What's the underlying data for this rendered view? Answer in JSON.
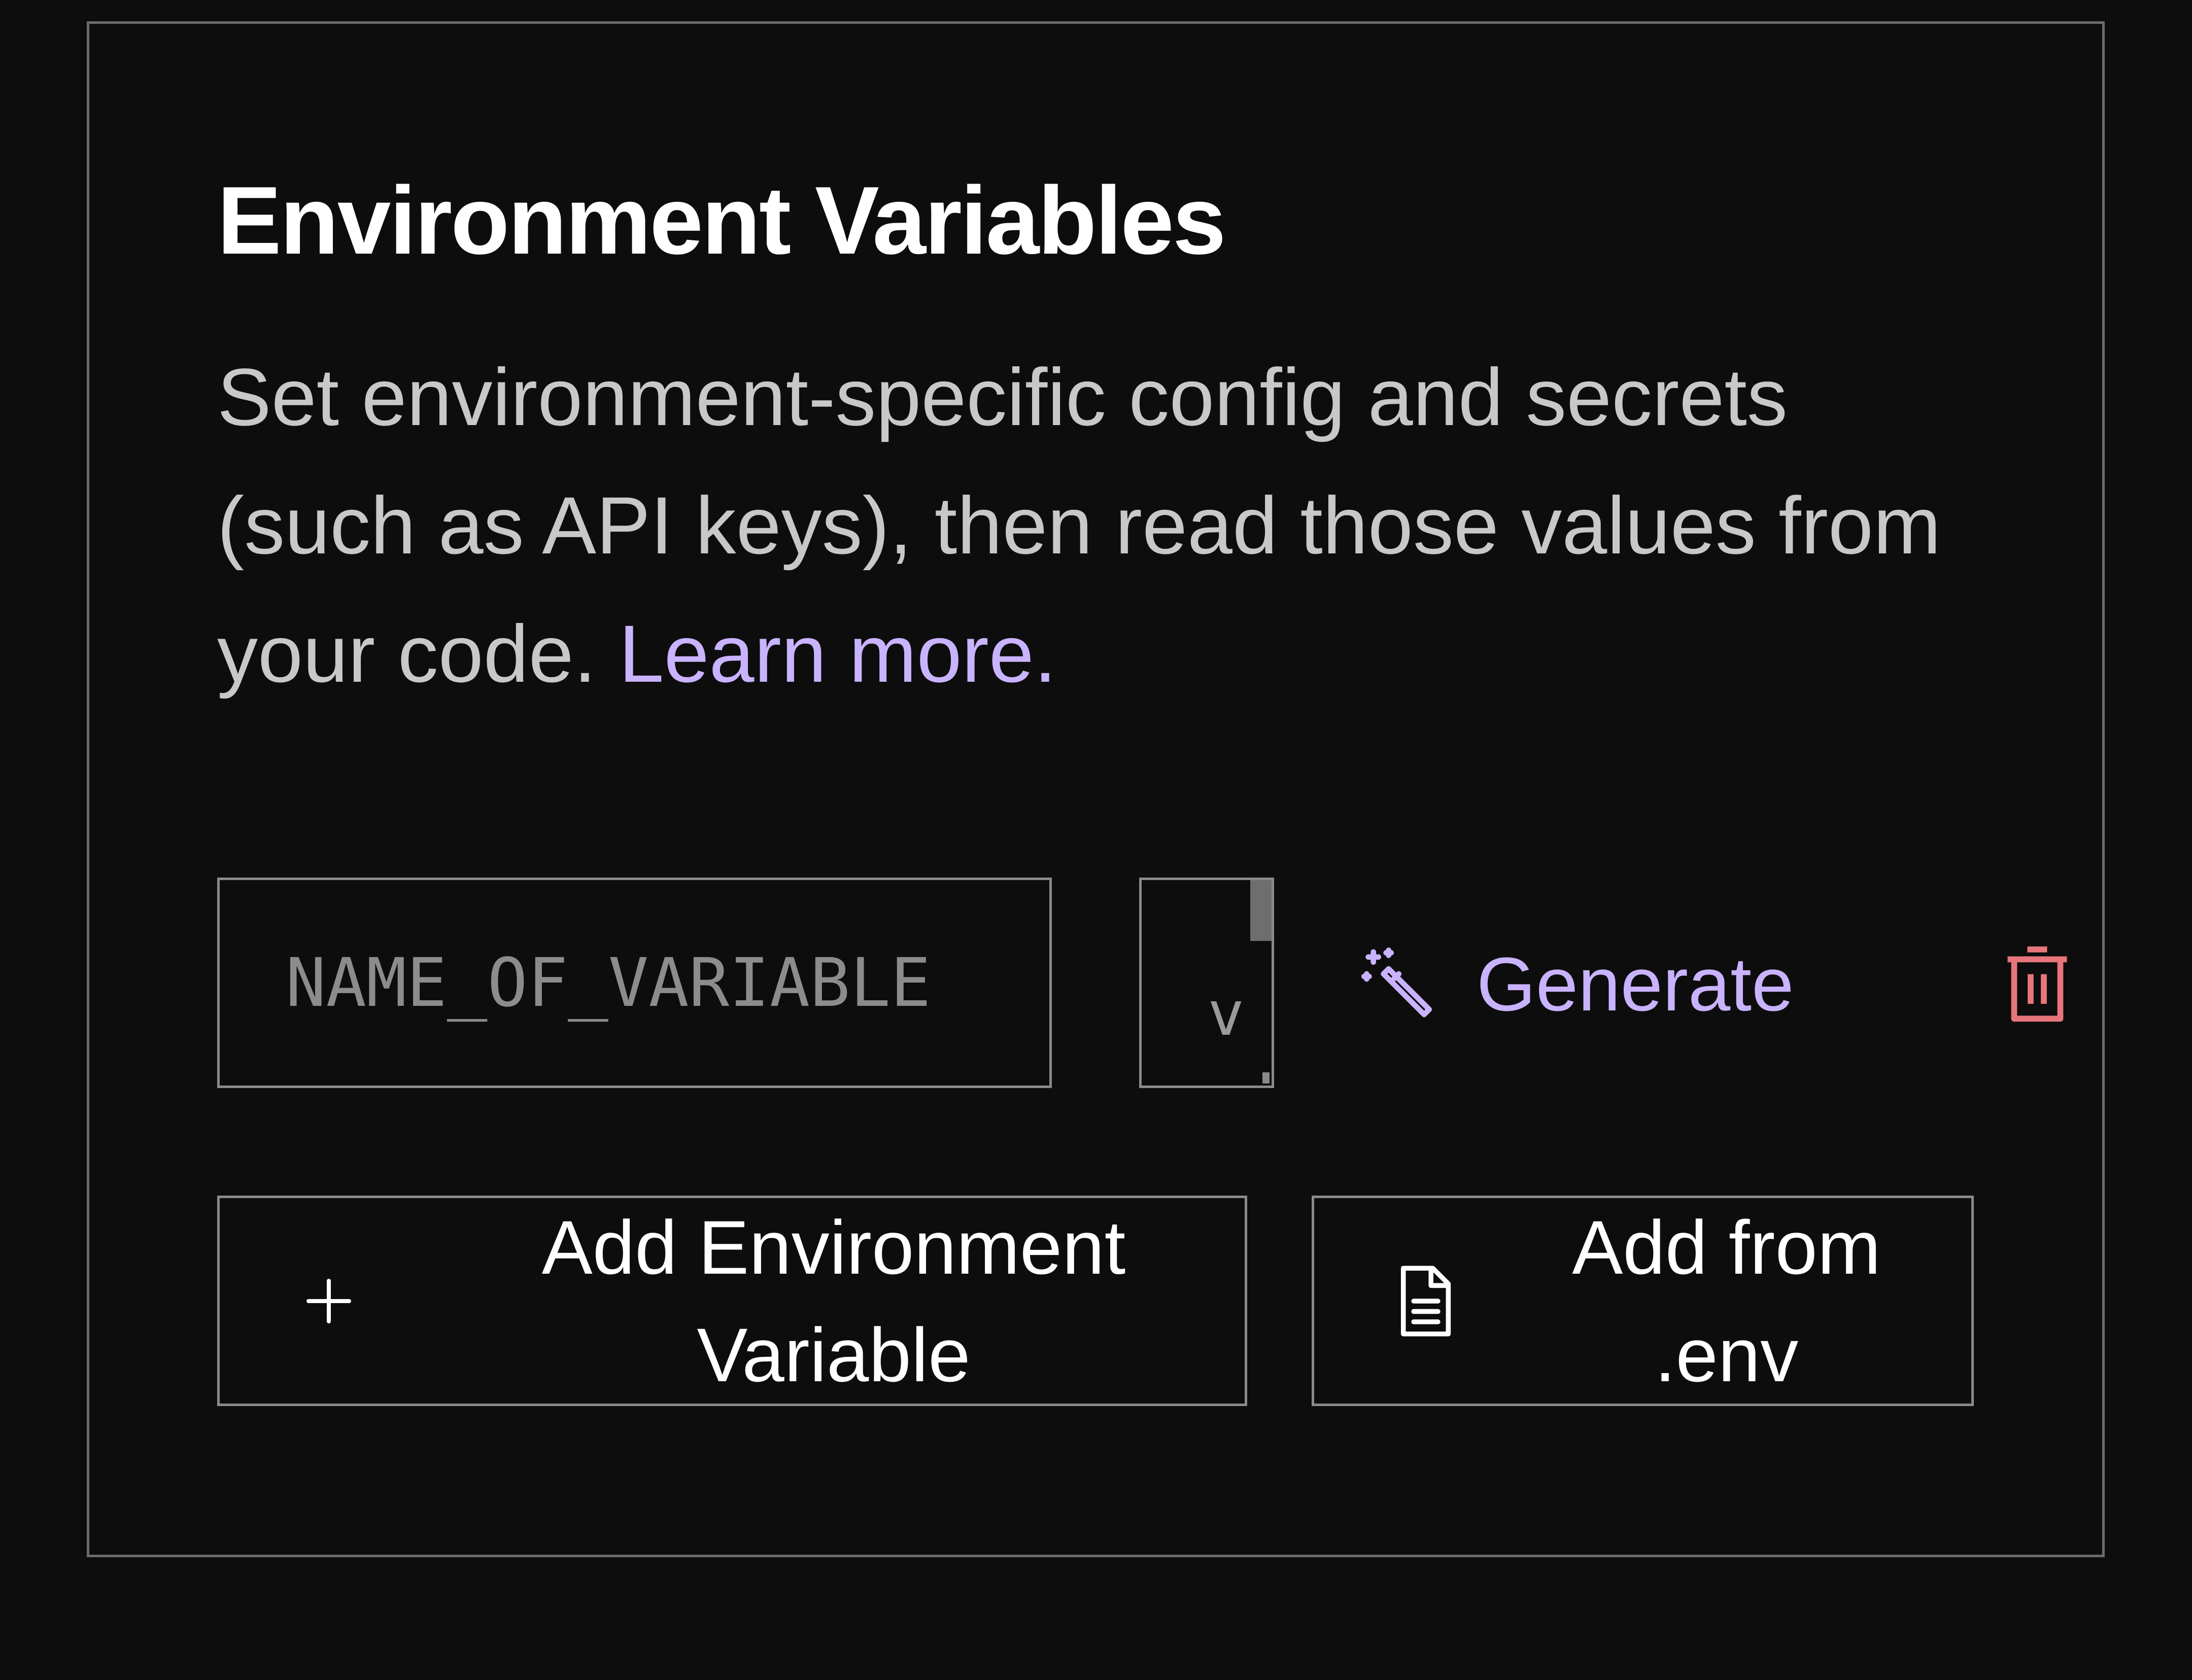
{
  "section": {
    "title": "Environment Variables",
    "description": "Set environment-specific config and secrets (such as API keys), then read those values from your code.",
    "learn_more_label": "Learn more."
  },
  "variable_row": {
    "name_placeholder": "NAME_OF_VARIABLE",
    "name_value": "",
    "value_placeholder": "value",
    "generate_label": "Generate"
  },
  "actions": {
    "add_variable_label": "Add Environment Variable",
    "add_from_env_label": "Add from .env"
  },
  "icons": {
    "generate": "magic-wand-icon",
    "delete": "trash-icon",
    "add": "plus-icon",
    "env_file": "file-icon"
  },
  "colors": {
    "background": "#0d0d0d",
    "border": "#8a8a8a",
    "accent": "#c9b3ff",
    "danger": "#e8757c",
    "description_text": "#c8c8c8"
  }
}
